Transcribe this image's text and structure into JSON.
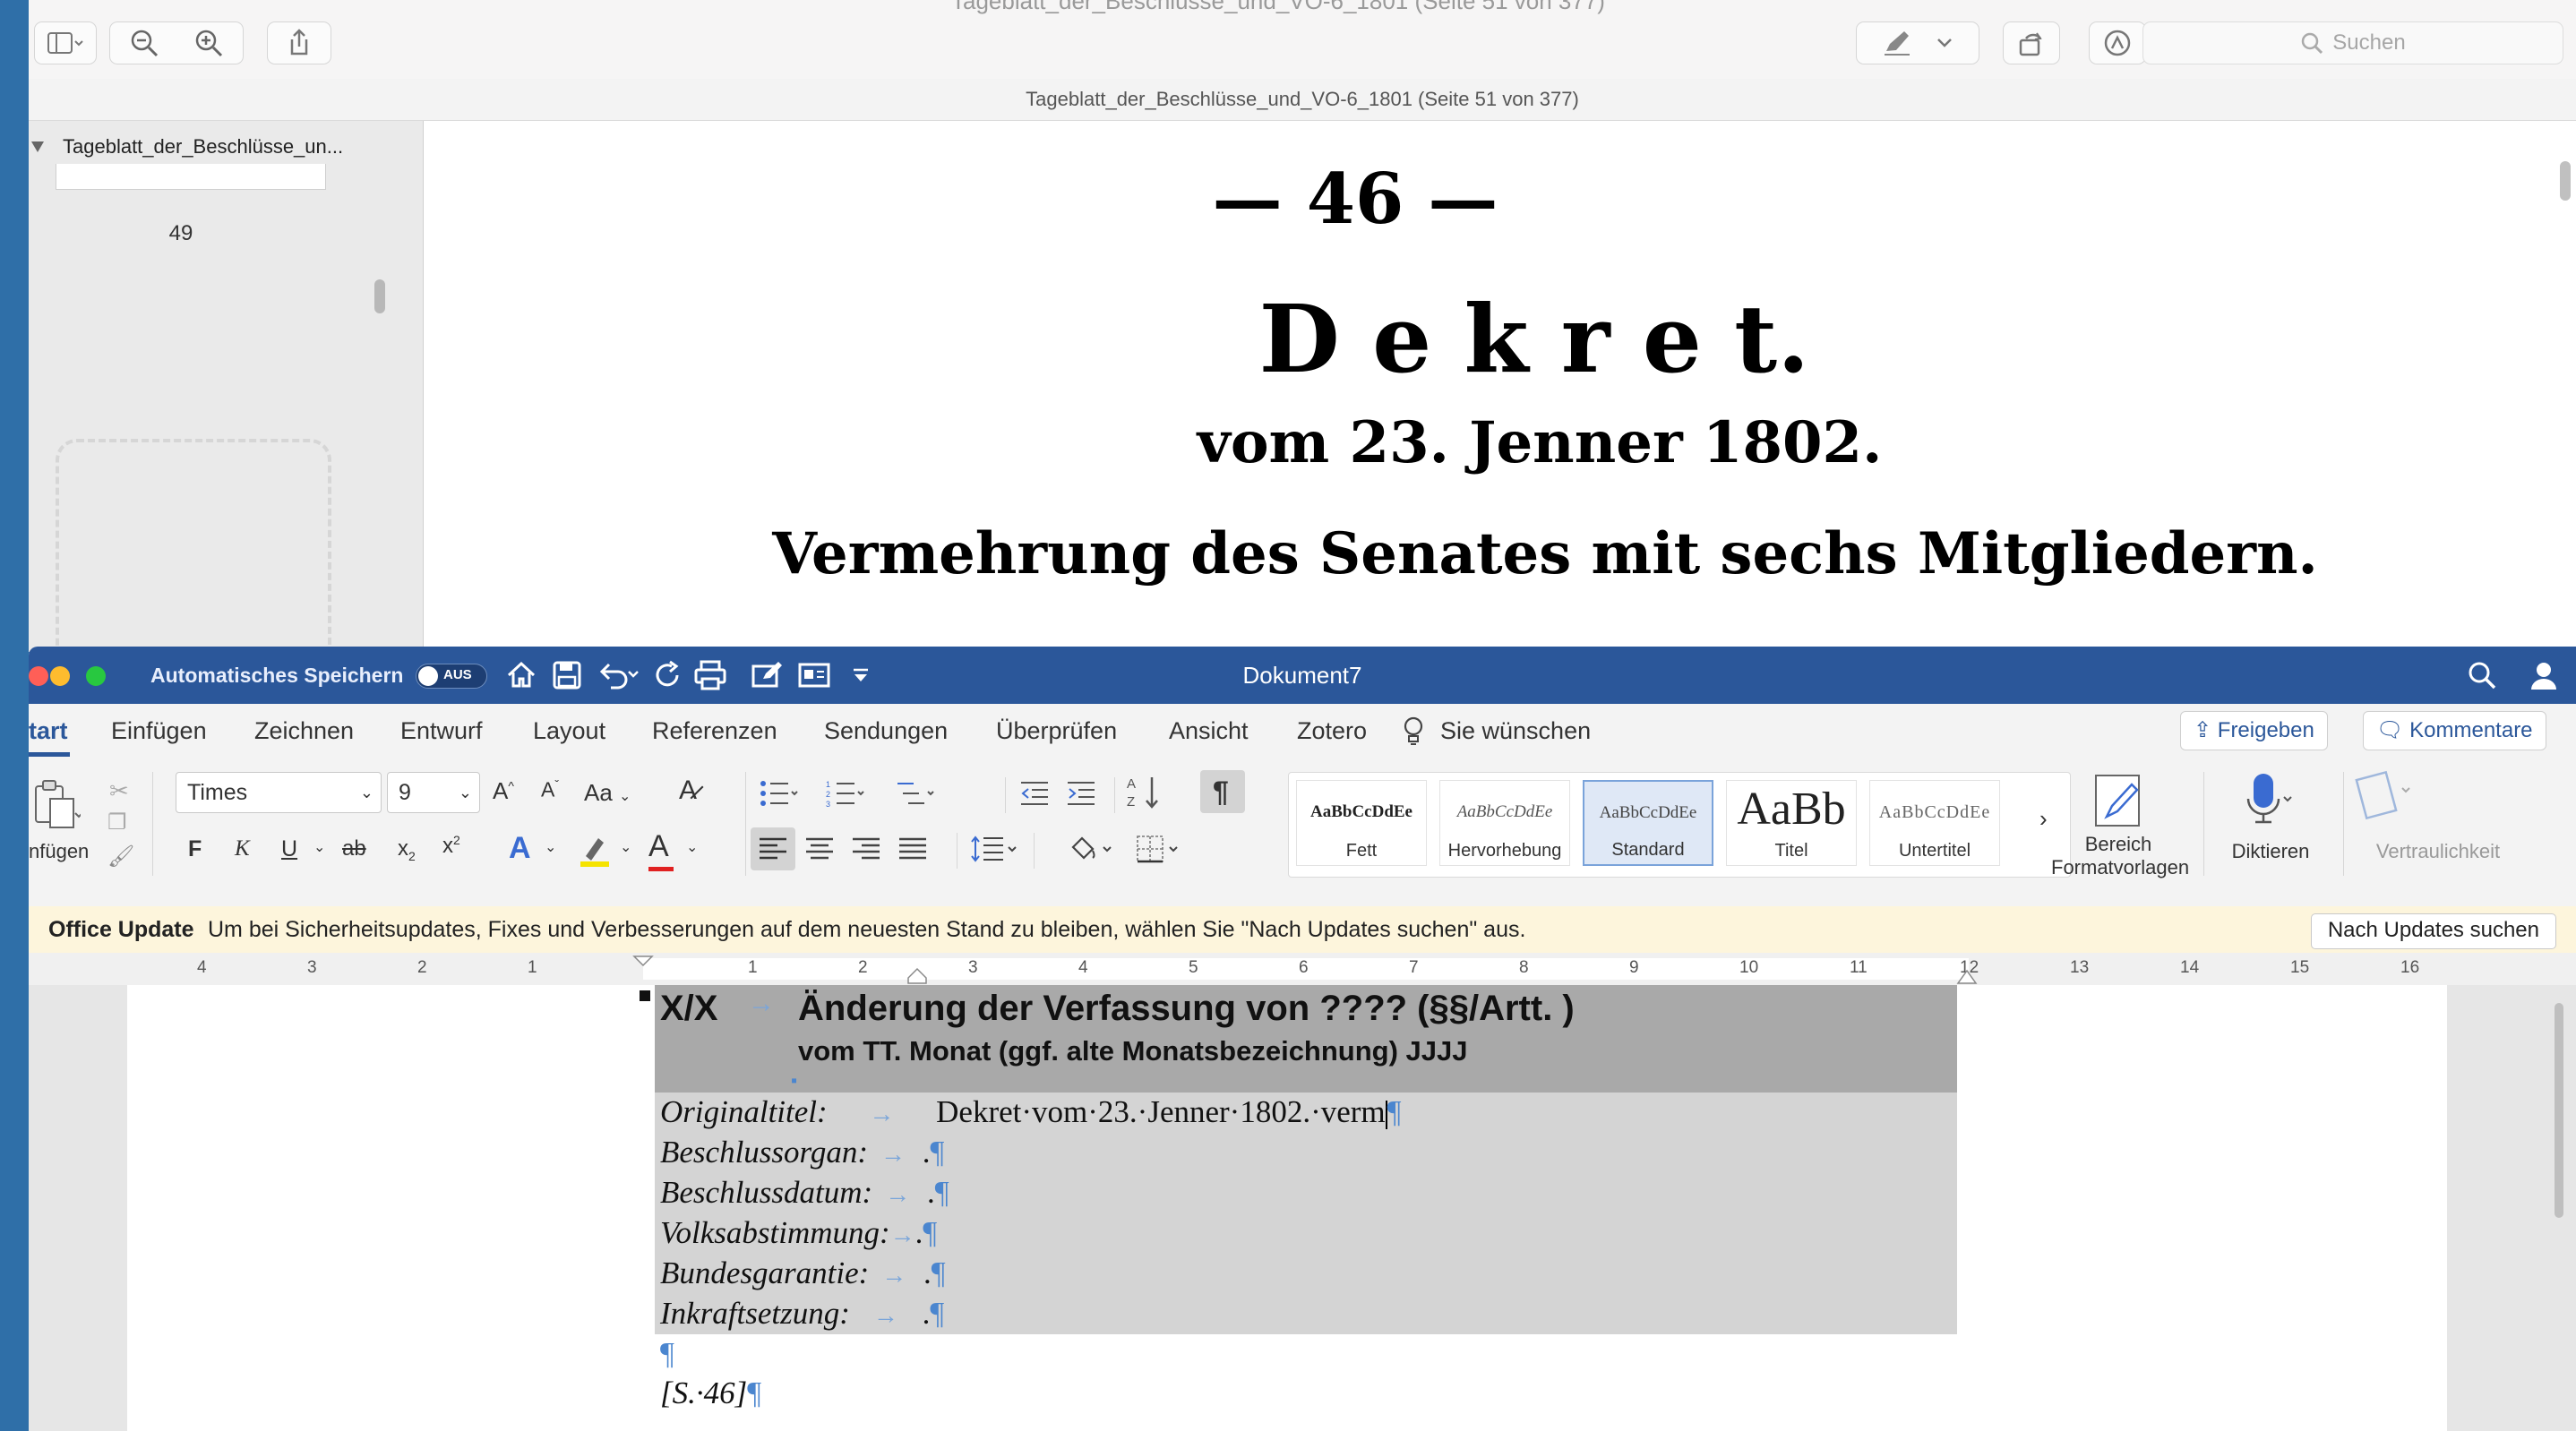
{
  "preview": {
    "window_title": "Tageblatt_der_Beschlüsse_und_VO-6_1801 (Seite 51 von 377)",
    "subtitle": "Tageblatt_der_Beschlüsse_und_VO-6_1801 (Seite 51 von 377)",
    "search_placeholder": "Suchen",
    "sidebar": {
      "document_label": "Tageblatt_der_Beschlüsse_un...",
      "page_number": "49"
    },
    "page": {
      "number_line": "— 46 —",
      "heading": "D e k r e t.",
      "date_line": "vom 23. Jenner 1802.",
      "subject_line": "Vermehrung des Senates mit sechs Mitgliedern."
    }
  },
  "word": {
    "autosave_label": "Automatisches Speichern",
    "autosave_state": "AUS",
    "document_title": "Dokument7",
    "tabs": [
      "tart",
      "Einfügen",
      "Zeichnen",
      "Entwurf",
      "Layout",
      "Referenzen",
      "Sendungen",
      "Überprüfen",
      "Ansicht",
      "Zotero",
      "Sie wünschen"
    ],
    "share_label": "Freigeben",
    "comments_label": "Kommentare",
    "ribbon": {
      "paste_label": "nfügen",
      "font_name": "Times",
      "font_size": "9",
      "case_label": "Aa",
      "bold": "F",
      "italic": "K",
      "underline": "U",
      "strike": "ab",
      "pilcrow": "¶",
      "styles": [
        {
          "preview": "AaBbCcDdEe",
          "label": "Fett"
        },
        {
          "preview": "AaBbCcDdEe",
          "label": "Hervorhebung"
        },
        {
          "preview": "AaBbCcDdEe",
          "label": "Standard"
        },
        {
          "preview": "AaBb",
          "label": "Titel"
        },
        {
          "preview": "AaBbCcDdEe",
          "label": "Untertitel"
        }
      ],
      "styles_pane_line1": "Bereich",
      "styles_pane_line2": "Formatvorlagen",
      "dictate_label": "Diktieren",
      "sensitivity_label": "Vertraulichkeit"
    },
    "update_bar": {
      "title": "Office Update",
      "message": "Um bei Sicherheitsupdates, Fixes und Verbesserungen auf dem neuesten Stand zu bleiben, wählen Sie \"Nach Updates suchen\" aus.",
      "button": "Nach Updates suchen"
    },
    "ruler_numbers": [
      "4",
      "3",
      "2",
      "1",
      "1",
      "2",
      "3",
      "4",
      "5",
      "6",
      "7",
      "8",
      "9",
      "10",
      "11",
      "12",
      "13",
      "14",
      "15",
      "16"
    ],
    "document": {
      "heading_number": "X/X",
      "heading_title": "Änderung der Verfassung von ???? (§§/Artt. )",
      "heading_sub": "vom TT. Monat (ggf. alte Monatsbezeichnung) JJJJ",
      "fields": [
        {
          "label": "Originaltitel:",
          "value": "Dekret·vom·23.·Jenner·1802.·verm"
        },
        {
          "label": "Beschlussorgan:",
          "value": "."
        },
        {
          "label": "Beschlussdatum:",
          "value": "."
        },
        {
          "label": "Volksabstimmung:",
          "value": "."
        },
        {
          "label": "Bundesgarantie:",
          "value": "."
        },
        {
          "label": "Inkraftsetzung:",
          "value": "."
        }
      ],
      "page_ref": "[S.·46]",
      "pilcrow": "¶"
    }
  }
}
